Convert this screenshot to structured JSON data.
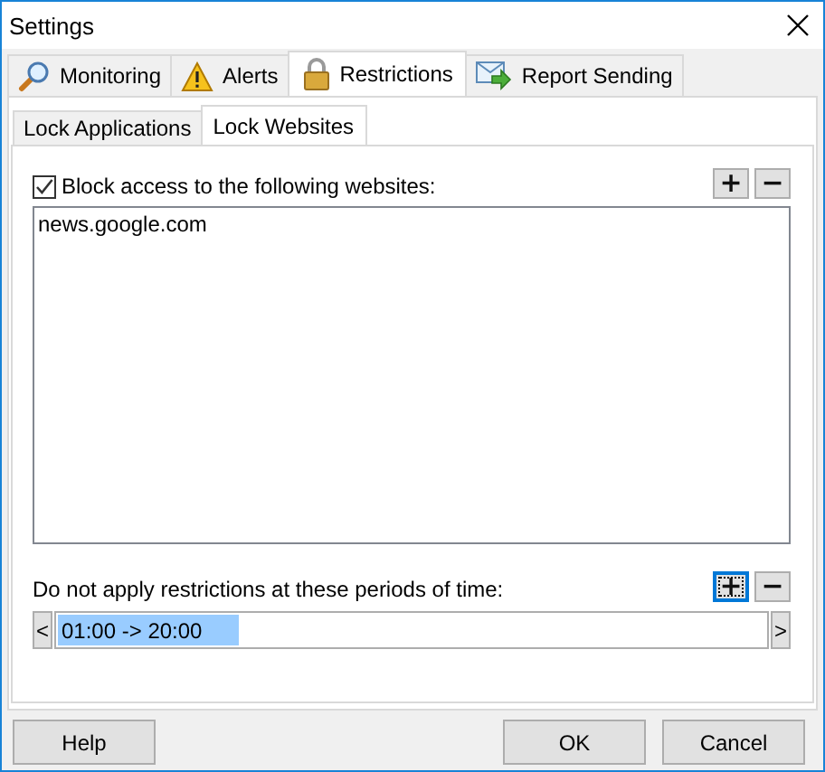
{
  "window": {
    "title": "Settings"
  },
  "tabs": [
    {
      "label": "Monitoring",
      "selected": false
    },
    {
      "label": "Alerts",
      "selected": false
    },
    {
      "label": "Restrictions",
      "selected": true
    },
    {
      "label": "Report Sending",
      "selected": false
    }
  ],
  "subtabs": [
    {
      "label": "Lock Applications",
      "selected": false
    },
    {
      "label": "Lock Websites",
      "selected": true
    }
  ],
  "block_checkbox": {
    "label": "Block access to the following websites:",
    "checked": true
  },
  "website_buttons": [
    {
      "label": "+",
      "focused": false
    },
    {
      "label": "−",
      "focused": false
    }
  ],
  "websites": [
    "news.google.com"
  ],
  "periods_label": "Do not apply restrictions at these periods of time:",
  "period_buttons": [
    {
      "label": "+",
      "focused": true
    },
    {
      "label": "−",
      "focused": false
    }
  ],
  "periods": {
    "scroll_left": "<",
    "scroll_right": ">",
    "items": [
      {
        "text": "01:00 -> 20:00",
        "selected": true
      }
    ]
  },
  "buttons": [
    "Help",
    "OK",
    "Cancel"
  ]
}
